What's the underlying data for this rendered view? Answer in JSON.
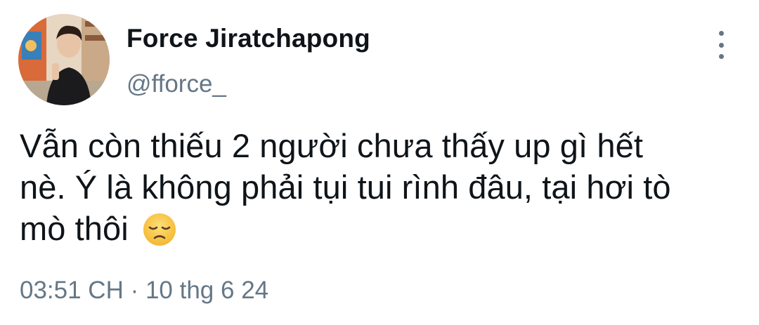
{
  "author": {
    "display_name": "Force Jiratchapong",
    "handle": "@fforce_"
  },
  "tweet": {
    "lines": [
      "Vẫn còn thiếu 2 người chưa thấy up gì hết",
      "nè. Ý là không phải tụi tui rình đâu, tại hơi tò",
      "mò thôi"
    ],
    "emoji": "disappointed-face-emoji"
  },
  "meta": {
    "timestamp": "03:51 CH · 10 thg 6 24"
  },
  "icons": {
    "more": "more-vertical-icon"
  },
  "colors": {
    "text": "#0f1419",
    "secondary": "#657786",
    "background": "#ffffff",
    "emoji_face": "#f7c843"
  }
}
